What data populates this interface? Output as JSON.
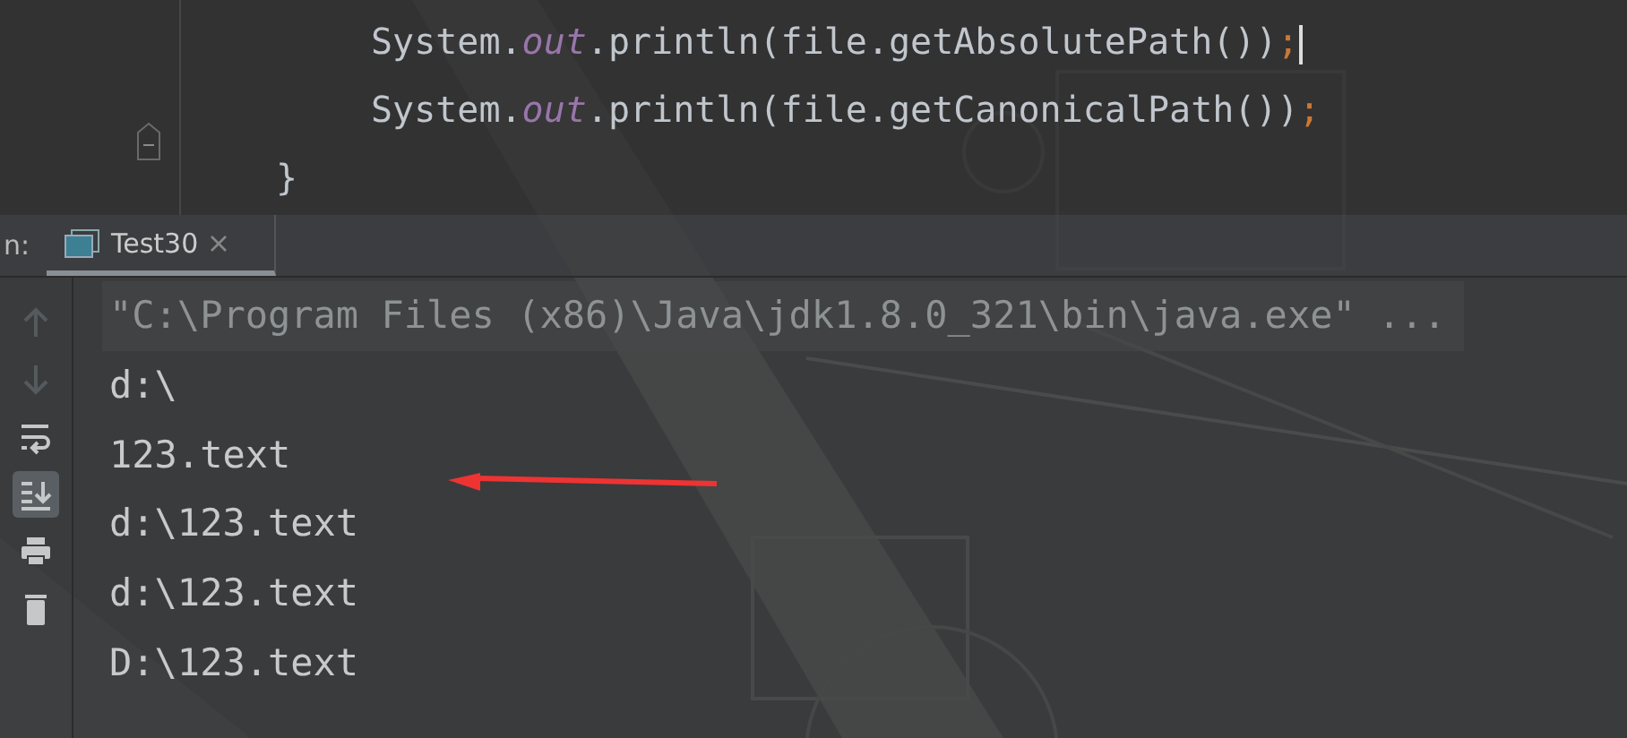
{
  "editor": {
    "lines": [
      {
        "kind": "statement",
        "tokens": [
          {
            "kind": "plain",
            "text": "System."
          },
          {
            "kind": "field",
            "text": "out"
          },
          {
            "kind": "plain",
            "text": ".println(file.getAbsolutePath())"
          },
          {
            "kind": "punct",
            "text": ";"
          }
        ],
        "caret": true
      },
      {
        "kind": "statement",
        "tokens": [
          {
            "kind": "plain",
            "text": "System."
          },
          {
            "kind": "field",
            "text": "out"
          },
          {
            "kind": "plain",
            "text": ".println(file.getCanonicalPath())"
          },
          {
            "kind": "punct",
            "text": ";"
          }
        ],
        "caret": false
      },
      {
        "kind": "brace",
        "tokens": [
          {
            "kind": "plain",
            "text": "}"
          }
        ],
        "caret": false
      }
    ]
  },
  "run_panel": {
    "label": "n:",
    "tabs": [
      {
        "title": "Test30",
        "selected": true
      }
    ],
    "toolbar": [
      {
        "kind": "up",
        "disabled": true,
        "selected": false
      },
      {
        "kind": "down",
        "disabled": true,
        "selected": false
      },
      {
        "kind": "wrap",
        "disabled": false,
        "selected": false
      },
      {
        "kind": "scroll",
        "disabled": false,
        "selected": true
      },
      {
        "kind": "print",
        "disabled": false,
        "selected": false
      },
      {
        "kind": "trash",
        "disabled": false,
        "selected": false
      }
    ],
    "console": [
      {
        "kind": "command",
        "text": "\"C:\\Program Files (x86)\\Java\\jdk1.8.0_321\\bin\\java.exe\" ..."
      },
      {
        "kind": "output",
        "text": "d:\\"
      },
      {
        "kind": "output",
        "text": "123.text"
      },
      {
        "kind": "output",
        "text": "d:\\123.text"
      },
      {
        "kind": "output",
        "text": "d:\\123.text"
      },
      {
        "kind": "output",
        "text": "D:\\123.text"
      }
    ]
  }
}
